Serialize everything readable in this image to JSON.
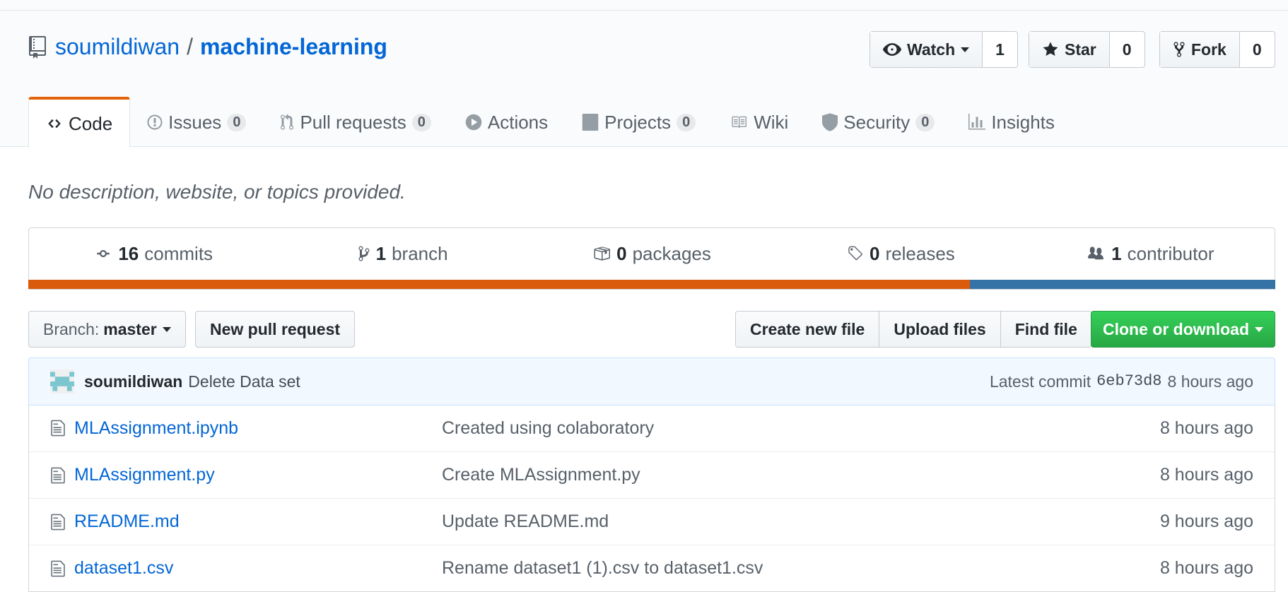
{
  "repo": {
    "owner": "soumildiwan",
    "separator": "/",
    "name": "machine-learning"
  },
  "social": {
    "watch_label": "Watch",
    "watch_count": "1",
    "star_label": "Star",
    "star_count": "0",
    "fork_label": "Fork",
    "fork_count": "0"
  },
  "tabs": [
    {
      "label": "Code",
      "icon": "code-icon"
    },
    {
      "label": "Issues",
      "counter": "0",
      "icon": "issue-icon"
    },
    {
      "label": "Pull requests",
      "counter": "0",
      "icon": "pull-request-icon"
    },
    {
      "label": "Actions",
      "icon": "play-icon"
    },
    {
      "label": "Projects",
      "counter": "0",
      "icon": "project-icon"
    },
    {
      "label": "Wiki",
      "icon": "book-icon"
    },
    {
      "label": "Security",
      "counter": "0",
      "icon": "shield-icon"
    },
    {
      "label": "Insights",
      "icon": "graph-icon"
    }
  ],
  "description": "No description, website, or topics provided.",
  "numbers": [
    {
      "count": "16",
      "label": "commits",
      "icon": "commit-icon"
    },
    {
      "count": "1",
      "label": "branch",
      "icon": "branch-icon"
    },
    {
      "count": "0",
      "label": "packages",
      "icon": "package-icon"
    },
    {
      "count": "0",
      "label": "releases",
      "icon": "tag-icon"
    },
    {
      "count": "1",
      "label": "contributor",
      "icon": "people-icon"
    }
  ],
  "language_bar": {
    "colors": [
      "#DA5B0B",
      "#3572A5"
    ],
    "shares": [
      0.755,
      0.245
    ]
  },
  "toolbar": {
    "branch_prefix": "Branch:",
    "branch_name": "master",
    "new_pull_request": "New pull request",
    "create_new_file": "Create new file",
    "upload_files": "Upload files",
    "find_file": "Find file",
    "clone_or_download": "Clone or download"
  },
  "latest_commit": {
    "author": "soumildiwan",
    "message": "Delete Data set",
    "prefix": "Latest commit",
    "sha": "6eb73d8",
    "age": "8 hours ago"
  },
  "files": [
    {
      "name": "MLAssignment.ipynb",
      "message": "Created using colaboratory",
      "age": "8 hours ago"
    },
    {
      "name": "MLAssignment.py",
      "message": "Create MLAssignment.py",
      "age": "8 hours ago"
    },
    {
      "name": "README.md",
      "message": "Update README.md",
      "age": "9 hours ago"
    },
    {
      "name": "dataset1.csv",
      "message": "Rename dataset1 (1).csv to dataset1.csv",
      "age": "8 hours ago"
    }
  ],
  "colors": {
    "link": "#0366d6",
    "selected_tab_accent": "#e36209",
    "clone_button": "#28a745"
  }
}
